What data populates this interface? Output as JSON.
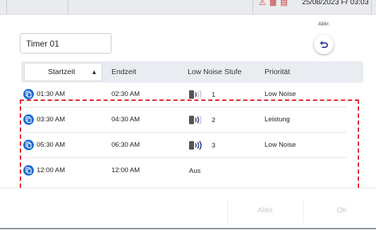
{
  "status_bar": {
    "icons": [
      "warning-triangle-icon",
      "heater-icon",
      "book-icon"
    ],
    "icon_glyphs": "⚠ ▦ ▤",
    "datetime": "25/08/2023 Fr 03:03"
  },
  "dialog": {
    "timer_name": "Timer 01",
    "back_label": "Abbr.",
    "columns": {
      "start": "Startzeit",
      "end": "Endzeit",
      "level": "Low Noise Stufe",
      "priority": "Priorität"
    },
    "rows": [
      {
        "start": "01:30 AM",
        "end": "02:30 AM",
        "level": "1",
        "priority": "Low Noise",
        "bars": 1
      },
      {
        "start": "03:30 AM",
        "end": "04:30 AM",
        "level": "2",
        "priority": "Leistung",
        "bars": 2
      },
      {
        "start": "05:30 AM",
        "end": "06:30 AM",
        "level": "3",
        "priority": "Low Noise",
        "bars": 3
      },
      {
        "start": "12:00 AM",
        "end": "12:00 AM",
        "level": "Aus",
        "priority": "",
        "bars": 0
      }
    ],
    "footer": {
      "cancel": "Abbr.",
      "ok": "OK"
    }
  },
  "colors": {
    "accent": "#1f6fd6",
    "selection": "#e2232e"
  }
}
